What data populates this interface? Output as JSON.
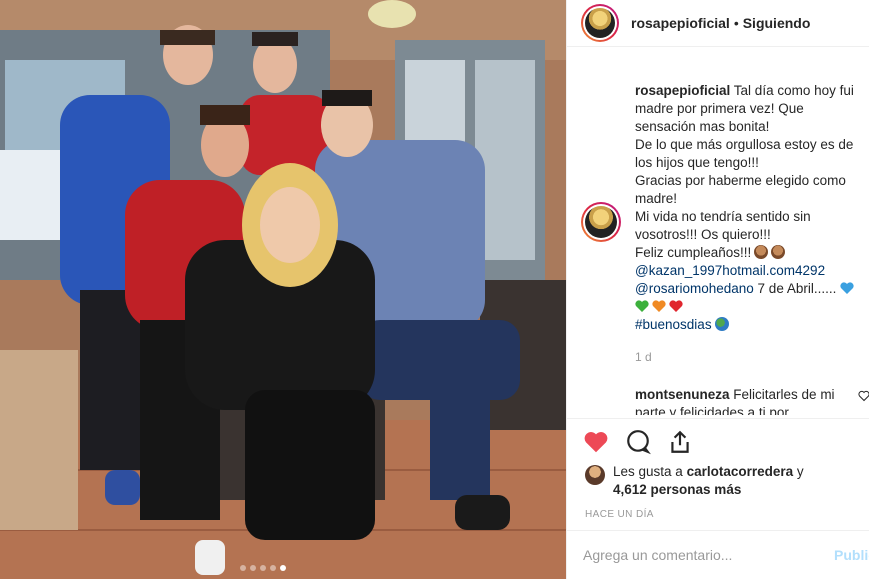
{
  "post": {
    "username": "rosapepioficial",
    "separator": "•",
    "follow_status": "Siguiendo"
  },
  "caption": {
    "username": "rosapepioficial",
    "line1": "Tal día como hoy fui madre por primera vez! Que sensación mas bonita!",
    "line2": "De lo que más orgullosa estoy es de los hijos que tengo!!!",
    "line3": "Gracias por haberme elegido como madre!",
    "line4": "Mi vida no tendría sentido sin vosotros!!! Os quiero!!!",
    "line5": "Feliz cumpleaños!!!",
    "mention1": "@kazan_1997hotmail.com4292",
    "mention2": "@rosariomohedano",
    "date_text": "7 de Abril......",
    "hashtag": "#buenosdias",
    "time": "1 d"
  },
  "comment": {
    "username": "montsenuneza",
    "text": "Felicitarles de mi parte y felicidades a ti por"
  },
  "likes": {
    "prefix": "Les gusta a",
    "user": "carlotacorredera",
    "connector": "y",
    "count": "4,612 personas más"
  },
  "timestamp": "HACE UN DÍA",
  "add_comment": {
    "placeholder": "Agrega un comentario...",
    "publish": "Publicar"
  },
  "colors": {
    "like_red": "#ed4956",
    "link_blue": "#003569",
    "muted": "#999999"
  },
  "carousel": {
    "total": 5,
    "active": 5
  }
}
